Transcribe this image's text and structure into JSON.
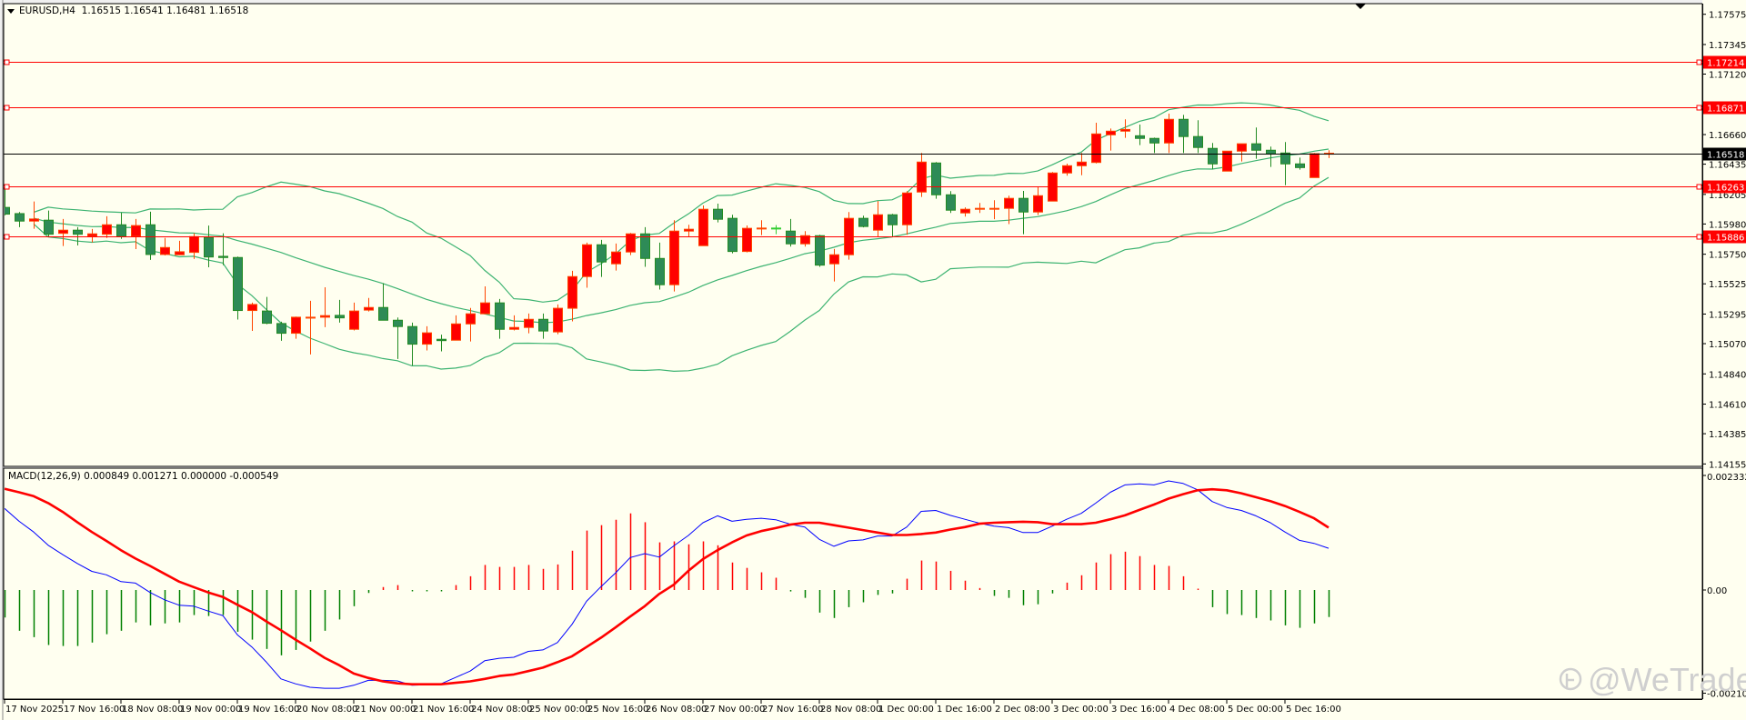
{
  "header": {
    "symbol": "EURUSD,H4",
    "ohlc": "1.16515 1.16541 1.16481 1.16518"
  },
  "macd_header": "MACD(12,26,9) 0.000849 0.001271 0.000000 -0.000549",
  "watermark": {
    "text": "@WeTrade",
    "logo": "WeTrade"
  },
  "colors": {
    "background": "#FFFFF0",
    "bull": "#FF0000",
    "bull_border": "#FF4500",
    "bear": "#2E8B57",
    "bear_border": "#228B22",
    "doji": "#32CD32",
    "bands": "#3CB371",
    "level_line": "#FF0000",
    "current_price": "#000000",
    "macd_line": "#0000FF",
    "signal_line": "#FF0000",
    "hist_pos": "#FF0000",
    "hist_neg": "#008000"
  },
  "price_axis": {
    "ticks": [
      "1.17575",
      "1.17345",
      "1.17120",
      "1.16660",
      "1.16435",
      "1.16205",
      "1.15980",
      "1.15750",
      "1.15525",
      "1.15295",
      "1.15070",
      "1.14840",
      "1.14610",
      "1.14385",
      "1.14155"
    ],
    "range": [
      1.14155,
      1.17575
    ]
  },
  "levels": [
    "1.17214",
    "1.16871",
    "1.16263",
    "1.15886"
  ],
  "current_price": "1.16518",
  "macd_axis": {
    "ticks": [
      "0.002332",
      "0.00",
      "-0.002101"
    ],
    "range": [
      -0.002101,
      0.002332
    ]
  },
  "time_axis": [
    "17 Nov 2025",
    "17 Nov 16:00",
    "18 Nov 08:00",
    "19 Nov 00:00",
    "19 Nov 16:00",
    "20 Nov 08:00",
    "21 Nov 00:00",
    "21 Nov 16:00",
    "24 Nov 08:00",
    "25 Nov 00:00",
    "25 Nov 16:00",
    "26 Nov 08:00",
    "27 Nov 00:00",
    "27 Nov 16:00",
    "28 Nov 08:00",
    "1 Dec 00:00",
    "1 Dec 16:00",
    "2 Dec 08:00",
    "3 Dec 00:00",
    "3 Dec 16:00",
    "4 Dec 08:00",
    "5 Dec 00:00",
    "5 Dec 16:00"
  ],
  "chart_data": {
    "type": "candlestick",
    "title": "EURUSD,H4",
    "bollinger": {
      "period": 20,
      "deviations": 2
    },
    "ohlc": [
      [
        1.16106,
        1.16267,
        1.16046,
        1.16055
      ],
      [
        1.16059,
        1.16071,
        1.15956,
        1.16002
      ],
      [
        1.16002,
        1.16151,
        1.15944,
        1.16018
      ],
      [
        1.16009,
        1.16082,
        1.15886,
        1.15902
      ],
      [
        1.15909,
        1.16018,
        1.15812,
        1.15933
      ],
      [
        1.15933,
        1.15956,
        1.15817,
        1.15902
      ],
      [
        1.15886,
        1.15942,
        1.1584,
        1.15905
      ],
      [
        1.15902,
        1.16039,
        1.15874,
        1.15974
      ],
      [
        1.15974,
        1.16066,
        1.15867,
        1.15886
      ],
      [
        1.15886,
        1.16018,
        1.15789,
        1.15968
      ],
      [
        1.15974,
        1.16073,
        1.15707,
        1.15748
      ],
      [
        1.15748,
        1.15874,
        1.15741,
        1.15801
      ],
      [
        1.15746,
        1.15852,
        1.15743,
        1.15769
      ],
      [
        1.15764,
        1.15909,
        1.15714,
        1.15884
      ],
      [
        1.15879,
        1.15968,
        1.15651,
        1.15729
      ],
      [
        1.15734,
        1.15909,
        1.15667,
        1.15725
      ],
      [
        1.15725,
        1.15732,
        1.15253,
        1.15322
      ],
      [
        1.15322,
        1.15382,
        1.15167,
        1.15368
      ],
      [
        1.15318,
        1.15425,
        1.15218,
        1.15225
      ],
      [
        1.15223,
        1.15237,
        1.15092,
        1.15149
      ],
      [
        1.15149,
        1.15276,
        1.15107,
        1.15271
      ],
      [
        1.15266,
        1.15396,
        1.14988,
        1.15271
      ],
      [
        1.15271,
        1.15499,
        1.15195,
        1.15283
      ],
      [
        1.15285,
        1.15403,
        1.1523,
        1.15266
      ],
      [
        1.15179,
        1.15382,
        1.1517,
        1.15318
      ],
      [
        1.15325,
        1.15417,
        1.15315,
        1.15345
      ],
      [
        1.15345,
        1.15529,
        1.15248,
        1.15248
      ],
      [
        1.15248,
        1.15269,
        1.14953,
        1.152
      ],
      [
        1.152,
        1.1523,
        1.14903,
        1.15066
      ],
      [
        1.15066,
        1.15202,
        1.15018,
        1.15152
      ],
      [
        1.15103,
        1.15138,
        1.15011,
        1.15093
      ],
      [
        1.15096,
        1.15285,
        1.15096,
        1.1522
      ],
      [
        1.1522,
        1.15341,
        1.15086,
        1.15297
      ],
      [
        1.15297,
        1.15506,
        1.15297,
        1.1538
      ],
      [
        1.1538,
        1.1541,
        1.15107,
        1.15179
      ],
      [
        1.15179,
        1.15285,
        1.1517,
        1.15193
      ],
      [
        1.15193,
        1.15299,
        1.15149,
        1.15255
      ],
      [
        1.15255,
        1.15299,
        1.15107,
        1.15166
      ],
      [
        1.15159,
        1.15368,
        1.15142,
        1.15339
      ],
      [
        1.15339,
        1.15624,
        1.15239,
        1.1558
      ],
      [
        1.1558,
        1.15838,
        1.15495,
        1.15822
      ],
      [
        1.15822,
        1.15859,
        1.15577,
        1.15691
      ],
      [
        1.15677,
        1.15831,
        1.15626,
        1.15767
      ],
      [
        1.15767,
        1.15912,
        1.15743,
        1.15905
      ],
      [
        1.15905,
        1.15956,
        1.15654,
        1.15718
      ],
      [
        1.15718,
        1.15838,
        1.15481,
        1.15518
      ],
      [
        1.15518,
        1.16009,
        1.15467,
        1.15926
      ],
      [
        1.15926,
        1.15974,
        1.15886,
        1.1594
      ],
      [
        1.15815,
        1.16121,
        1.15815,
        1.16092
      ],
      [
        1.16092,
        1.16135,
        1.15992,
        1.16016
      ],
      [
        1.16023,
        1.1605,
        1.15757,
        1.15771
      ],
      [
        1.15771,
        1.15969,
        1.15764,
        1.15947
      ],
      [
        1.15947,
        1.16009,
        1.15895,
        1.15949
      ],
      [
        1.15949,
        1.15971,
        1.15902,
        1.15949
      ],
      [
        1.15926,
        1.16018,
        1.15808,
        1.15829
      ],
      [
        1.15829,
        1.15926,
        1.15808,
        1.15891
      ],
      [
        1.15891,
        1.15898,
        1.15654,
        1.15667
      ],
      [
        1.15677,
        1.1579,
        1.15543,
        1.15746
      ],
      [
        1.15746,
        1.16071,
        1.15709,
        1.16023
      ],
      [
        1.16023,
        1.16043,
        1.15954,
        1.15961
      ],
      [
        1.15933,
        1.16154,
        1.15886,
        1.1605
      ],
      [
        1.1605,
        1.16057,
        1.15886,
        1.15974
      ],
      [
        1.15974,
        1.1623,
        1.15898,
        1.16216
      ],
      [
        1.16223,
        1.1652,
        1.16186,
        1.16451
      ],
      [
        1.16444,
        1.16451,
        1.16172,
        1.16202
      ],
      [
        1.16202,
        1.1623,
        1.16064,
        1.16085
      ],
      [
        1.16064,
        1.16106,
        1.16036,
        1.16092
      ],
      [
        1.16092,
        1.1614,
        1.16064,
        1.16099
      ],
      [
        1.16096,
        1.16161,
        1.16016,
        1.16099
      ],
      [
        1.16099,
        1.16195,
        1.15979,
        1.16175
      ],
      [
        1.16175,
        1.16232,
        1.15902,
        1.16071
      ],
      [
        1.16071,
        1.16264,
        1.16048,
        1.16195
      ],
      [
        1.16154,
        1.16375,
        1.16154,
        1.16368
      ],
      [
        1.16368,
        1.16439,
        1.16347,
        1.16423
      ],
      [
        1.16423,
        1.1652,
        1.16351,
        1.16451
      ],
      [
        1.16448,
        1.1675,
        1.16441,
        1.16665
      ],
      [
        1.16658,
        1.16706,
        1.16538,
        1.16686
      ],
      [
        1.16686,
        1.16776,
        1.16635,
        1.16699
      ],
      [
        1.16651,
        1.16736,
        1.1658,
        1.16631
      ],
      [
        1.16631,
        1.16637,
        1.1652,
        1.16596
      ],
      [
        1.16596,
        1.16819,
        1.1652,
        1.16776
      ],
      [
        1.16776,
        1.1681,
        1.1652,
        1.16645
      ],
      [
        1.16645,
        1.16769,
        1.1652,
        1.16562
      ],
      [
        1.16555,
        1.16596,
        1.16396,
        1.16437
      ],
      [
        1.16382,
        1.16534,
        1.16382,
        1.16534
      ],
      [
        1.16534,
        1.1659,
        1.16455,
        1.1659
      ],
      [
        1.1659,
        1.16714,
        1.16476,
        1.16541
      ],
      [
        1.16541,
        1.16569,
        1.16414,
        1.16513
      ],
      [
        1.1652,
        1.16603,
        1.16275,
        1.16437
      ],
      [
        1.16437,
        1.16485,
        1.16393,
        1.16409
      ],
      [
        1.16333,
        1.1652,
        1.16333,
        1.16515
      ],
      [
        1.16515,
        1.16541,
        1.16481,
        1.16518
      ]
    ],
    "macd": {
      "params": "12,26,9",
      "histogram": [
        -0.00056,
        -0.00083,
        -0.00096,
        -0.00112,
        -0.00114,
        -0.00114,
        -0.00107,
        -0.0009,
        -0.00083,
        -0.00066,
        -0.00072,
        -0.00068,
        -0.00066,
        -0.00051,
        -0.00053,
        -0.00051,
        -0.00085,
        -0.00101,
        -0.0012,
        -0.00133,
        -0.00122,
        -0.00105,
        -0.00083,
        -0.0006,
        -0.00033,
        -6e-05,
        6e-05,
        0.0001,
        -2e-05,
        -2e-05,
        -2e-05,
        0.0001,
        0.00028,
        0.00051,
        0.00047,
        0.00047,
        0.00051,
        0.00043,
        0.00052,
        0.0008,
        0.00121,
        0.00132,
        0.00143,
        0.00156,
        0.00138,
        0.00097,
        0.00099,
        0.00093,
        0.00099,
        0.00091,
        0.00056,
        0.00045,
        0.00036,
        0.00025,
        -3e-05,
        -0.00016,
        -0.00046,
        -0.00057,
        -0.00035,
        -0.00025,
        -0.0001,
        -7e-05,
        0.00023,
        0.0006,
        0.00058,
        0.00039,
        0.00019,
        4e-05,
        -0.00012,
        -0.00016,
        -0.00031,
        -0.00029,
        -7e-05,
        0.00015,
        0.0003,
        0.00056,
        0.00073,
        0.00078,
        0.00069,
        0.00051,
        0.00049,
        0.00028,
        2e-05,
        -0.00035,
        -0.00049,
        -0.00051,
        -0.00057,
        -0.00062,
        -0.00072,
        -0.00077,
        -0.00068,
        -0.00055
      ],
      "macd_line": [
        0.00166,
        0.0014,
        0.00118,
        0.00091,
        0.00072,
        0.00054,
        0.00038,
        0.00031,
        0.00017,
        0.00014,
        -5e-05,
        -0.0002,
        -0.00031,
        -0.00033,
        -0.00043,
        -0.00052,
        -0.00091,
        -0.00116,
        -0.00147,
        -0.00181,
        -0.00191,
        -0.00198,
        -0.002,
        -0.002,
        -0.00194,
        -0.00184,
        -0.00184,
        -0.00185,
        -0.00194,
        -0.00193,
        -0.00191,
        -0.00178,
        -0.00165,
        -0.00144,
        -0.00139,
        -0.00137,
        -0.00125,
        -0.00122,
        -0.00107,
        -0.0007,
        -0.00023,
        7e-05,
        0.00035,
        0.00066,
        0.00074,
        0.00067,
        0.0009,
        0.00111,
        0.00137,
        0.00151,
        0.0014,
        0.00144,
        0.00146,
        0.00143,
        0.00134,
        0.00128,
        0.00103,
        0.00089,
        0.001,
        0.00102,
        0.0011,
        0.0011,
        0.00128,
        0.0016,
        0.00162,
        0.00152,
        0.00144,
        0.00136,
        0.0013,
        0.00127,
        0.00117,
        0.00117,
        0.0013,
        0.00144,
        0.00156,
        0.00177,
        0.00199,
        0.00214,
        0.00216,
        0.00214,
        0.00222,
        0.00217,
        0.00204,
        0.0018,
        0.00168,
        0.00162,
        0.00151,
        0.00137,
        0.00118,
        0.00101,
        0.00095,
        0.00085
      ],
      "signal_line": [
        0.00206,
        0.00199,
        0.00191,
        0.00177,
        0.00159,
        0.00138,
        0.00118,
        0.001,
        0.00081,
        0.00064,
        0.00049,
        0.00033,
        0.00017,
        6e-05,
        -5e-05,
        -0.00014,
        -0.0003,
        -0.00045,
        -0.00064,
        -0.00082,
        -0.00101,
        -0.00119,
        -0.00138,
        -0.00153,
        -0.0017,
        -0.00179,
        -0.00186,
        -0.0019,
        -0.00192,
        -0.00192,
        -0.00192,
        -0.00189,
        -0.00186,
        -0.00181,
        -0.00175,
        -0.00172,
        -0.00165,
        -0.00158,
        -0.00147,
        -0.00135,
        -0.00116,
        -0.00097,
        -0.00076,
        -0.00054,
        -0.00033,
        -8e-05,
        0.00011,
        0.00039,
        0.00063,
        0.00081,
        0.00097,
        0.00111,
        0.0012,
        0.00126,
        0.00133,
        0.00137,
        0.00137,
        0.00132,
        0.00127,
        0.00122,
        0.00117,
        0.00112,
        0.00112,
        0.00114,
        0.00117,
        0.00123,
        0.00128,
        0.00135,
        0.00137,
        0.00138,
        0.00139,
        0.00138,
        0.00134,
        0.00134,
        0.00134,
        0.00137,
        0.00144,
        0.00152,
        0.00163,
        0.00174,
        0.00186,
        0.00195,
        0.00203,
        0.00205,
        0.00203,
        0.00197,
        0.00189,
        0.00181,
        0.00171,
        0.00159,
        0.00146,
        0.00127
      ]
    }
  }
}
